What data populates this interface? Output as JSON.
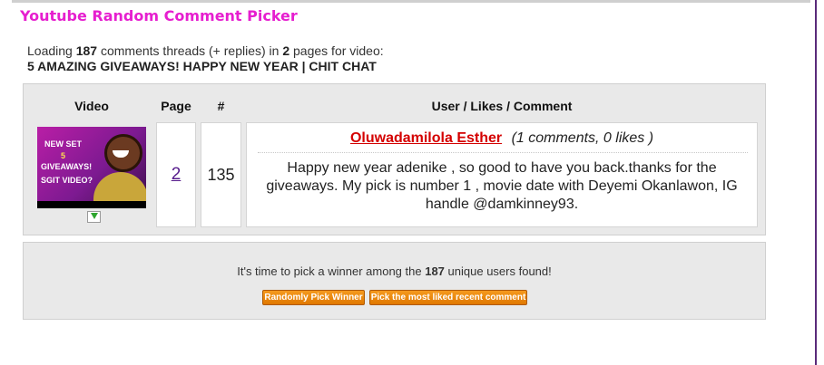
{
  "app_title": "Youtube Random Comment Picker",
  "loading": {
    "prefix": "Loading",
    "thread_count": "187",
    "middle": "comments threads (+ replies) in",
    "page_count": "2",
    "suffix": "pages for video:",
    "video_title": "5 AMAZING GIVEAWAYS! HAPPY NEW YEAR | CHIT CHAT"
  },
  "table": {
    "headers": {
      "video": "Video",
      "page": "Page",
      "number": "#",
      "user": "User / Likes / Comment"
    },
    "thumbnail": {
      "line1": "NEW SET",
      "line2": "5",
      "line3": "GIVEAWAYS!",
      "line4": "SGIT VIDEO?"
    },
    "row": {
      "page": "2",
      "number": "135",
      "user_name": "Oluwadamilola Esther",
      "stats": "(1 comments, 0 likes )",
      "comment": "Happy new year adenike , so good to have you back.thanks for the giveaways. My pick is number 1 , movie date with Deyemi Okanlawon, IG handle @damkinney93."
    }
  },
  "pick": {
    "prefix": "It's time to pick a winner among the",
    "count": "187",
    "suffix": "unique users found!",
    "random_button": "Randomly Pick Winner",
    "liked_button": "Pick the most liked recent comment"
  },
  "icons": {
    "download": "download-arrow-icon"
  },
  "colors": {
    "title": "#e61ecf",
    "user": "#d40000",
    "button": "#f08a10",
    "panel": "#e9e9e9"
  }
}
